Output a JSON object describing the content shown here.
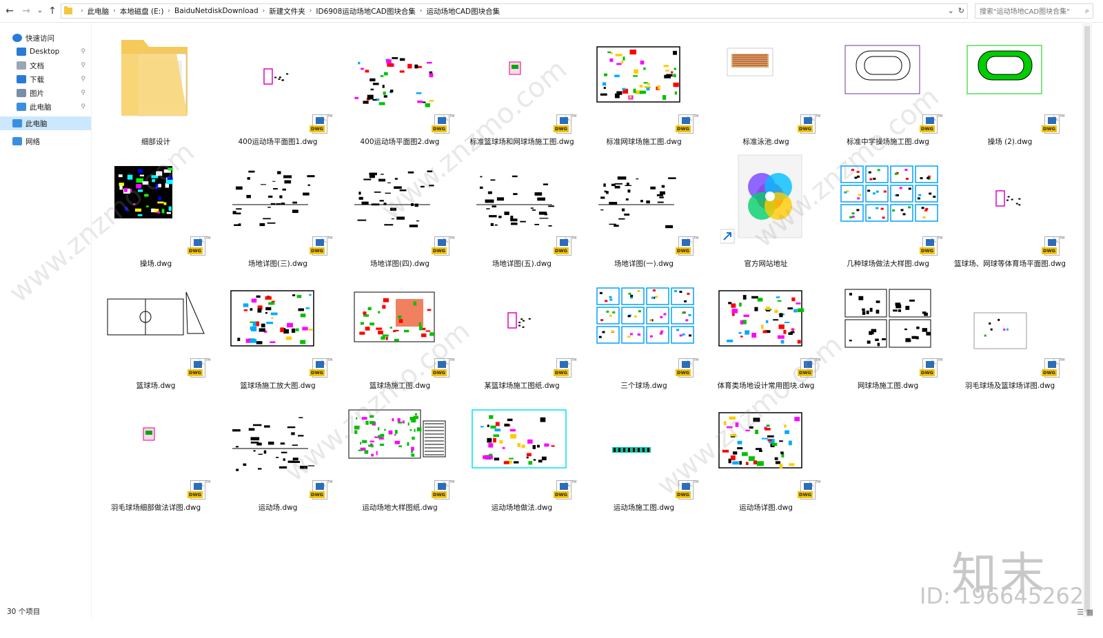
{
  "address_bar": {
    "crumbs": [
      "此电脑",
      "本地磁盘 (E:)",
      "BaiduNetdiskDownload",
      "新建文件夹",
      "ID6908运动场地CAD图块合集",
      "运动场地CAD图块合集"
    ],
    "search_placeholder": "搜索\"运动场地CAD图块合集\"",
    "refresh_icon": "refresh-icon",
    "dropdown_icon": "chevron-down-icon"
  },
  "nav": {
    "back": "←",
    "forward": "→",
    "recent": "⌄",
    "up": "↑"
  },
  "sidebar": {
    "items": [
      {
        "label": "快速访问",
        "icon": "star-icon",
        "pinned": false
      },
      {
        "label": "Desktop",
        "icon": "desktop-icon",
        "pinned": true
      },
      {
        "label": "文档",
        "icon": "document-icon",
        "pinned": true
      },
      {
        "label": "下载",
        "icon": "download-icon",
        "pinned": true
      },
      {
        "label": "图片",
        "icon": "picture-icon",
        "pinned": true
      },
      {
        "label": "此电脑",
        "icon": "computer-icon",
        "pinned": true
      },
      {
        "label": "此电脑",
        "icon": "computer-icon",
        "pinned": false
      },
      {
        "label": "网络",
        "icon": "network-icon",
        "pinned": false
      }
    ]
  },
  "files": [
    {
      "name": "细部设计",
      "kind": "folder"
    },
    {
      "name": "400运动场平面图1.dwg",
      "kind": "dwg",
      "thumb": "tiny"
    },
    {
      "name": "400运动场平面图2.dwg",
      "kind": "dwg",
      "thumb": "scatter"
    },
    {
      "name": "标准篮球场和网球场施工图.dwg",
      "kind": "dwg",
      "thumb": "small"
    },
    {
      "name": "标准网球场施工图.dwg",
      "kind": "dwg",
      "thumb": "sheet"
    },
    {
      "name": "标准泳池.dwg",
      "kind": "dwg",
      "thumb": "pool"
    },
    {
      "name": "标准中学操场施工图.dwg",
      "kind": "dwg",
      "thumb": "track"
    },
    {
      "name": "操场 (2).dwg",
      "kind": "dwg",
      "thumb": "track-green"
    },
    {
      "name": "操场.dwg",
      "kind": "dwg",
      "thumb": "grid-colored"
    },
    {
      "name": "场地详图(三).dwg",
      "kind": "dwg",
      "thumb": "details"
    },
    {
      "name": "场地详图(四).dwg",
      "kind": "dwg",
      "thumb": "details"
    },
    {
      "name": "场地详图(五).dwg",
      "kind": "dwg",
      "thumb": "details"
    },
    {
      "name": "场地详图(一).dwg",
      "kind": "dwg",
      "thumb": "details"
    },
    {
      "name": "官方网站地址",
      "kind": "shortcut"
    },
    {
      "name": "几种球场做法大样图.dwg",
      "kind": "dwg",
      "thumb": "cyan-grid"
    },
    {
      "name": "篮球场、网球等体育场平面图.dwg",
      "kind": "dwg",
      "thumb": "tiny"
    },
    {
      "name": "篮球场.dwg",
      "kind": "dwg",
      "thumb": "court"
    },
    {
      "name": "篮球场施工放大图.dwg",
      "kind": "dwg",
      "thumb": "sheet"
    },
    {
      "name": "篮球场施工图.dwg",
      "kind": "dwg",
      "thumb": "green-red"
    },
    {
      "name": "某篮球场施工图纸.dwg",
      "kind": "dwg",
      "thumb": "tiny"
    },
    {
      "name": "三个球场.dwg",
      "kind": "dwg",
      "thumb": "cyan-grid"
    },
    {
      "name": "体育类场地设计常用图块.dwg",
      "kind": "dwg",
      "thumb": "sheet"
    },
    {
      "name": "网球场施工图.dwg",
      "kind": "dwg",
      "thumb": "multi"
    },
    {
      "name": "羽毛球场及篮球场详图.dwg",
      "kind": "dwg",
      "thumb": "blank"
    },
    {
      "name": "羽毛球场细部做法详图.dwg",
      "kind": "dwg",
      "thumb": "small"
    },
    {
      "name": "运动场.dwg",
      "kind": "dwg",
      "thumb": "details"
    },
    {
      "name": "运动场地大样图纸.dwg",
      "kind": "dwg",
      "thumb": "green-sheet"
    },
    {
      "name": "运动场地做法.dwg",
      "kind": "dwg",
      "thumb": "cyan-sheet"
    },
    {
      "name": "运动场施工图.dwg",
      "kind": "dwg",
      "thumb": "strip"
    },
    {
      "name": "运动场详图.dwg",
      "kind": "dwg",
      "thumb": "sheet"
    }
  ],
  "badge_label": "DWG",
  "badge_tm": "TM",
  "status": {
    "count": "30 个项目"
  },
  "watermark": {
    "brand": "知末",
    "id": "ID: 196645262",
    "site": "www.znzmo.com"
  }
}
